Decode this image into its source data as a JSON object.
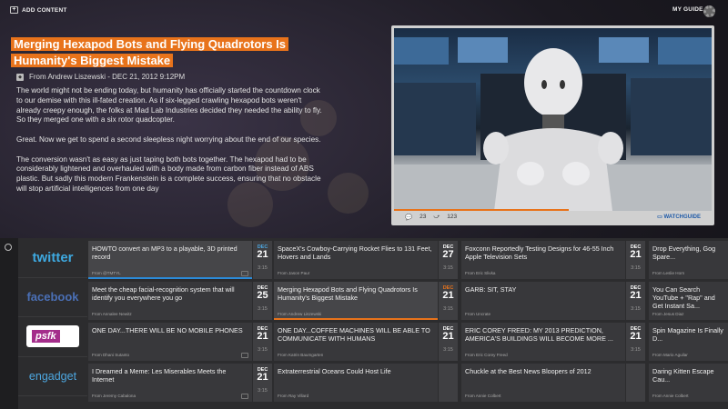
{
  "header": {
    "add_content": "ADD CONTENT",
    "my_guide": "MY GUIDE",
    "add_icon": "plus-square-icon",
    "settings_icon": "gear-icon"
  },
  "article": {
    "title": "Merging Hexapod Bots and Flying Quadrotors Is Humanity's Biggest Mistake",
    "byline": "From Andrew Liszewski - DEC 21, 2012 9:12PM",
    "paragraphs": [
      "The world might not be ending today, but humanity has officially started the countdown clock to our demise with this ill-fated creation. As if six-legged crawling hexapod bots weren't already creepy enough, the folks at Mad Lab Industries decided they needed the ability to fly. So they merged one with a six rotor quadcopter.",
      "Great. Now we get to spend a second sleepless night worrying about the end of our species.",
      "The conversion wasn't as easy as just taping both bots together. The hexapod had to be considerably lightened and overhauled with a body made from carbon fiber instead of ABS plastic. But sadly this modern Frankenstein is a complete success, ensuring that no obstacle will stop artificial intelligences from one day"
    ]
  },
  "video": {
    "comments": "23",
    "shares": "123",
    "watch_guide": "WATCHGUIDE",
    "progress": 0.55
  },
  "sources": [
    "twitter",
    "facebook",
    "psfk",
    "engadget"
  ],
  "rows": [
    [
      {
        "title": "HOWTO convert an MP3 to a playable, 3D printed record",
        "author": "From @TMTYL",
        "month": "DEC",
        "day": "21",
        "time": "3:15",
        "hl": true,
        "accent": "blue"
      },
      {
        "title": "SpaceX's Cowboy-Carrying Rocket Flies to 131 Feet, Hovers and Lands",
        "author": "From Jason Paur",
        "month": "DEC",
        "day": "27",
        "time": "3:15"
      },
      {
        "title": "Foxconn Reportedly Testing Designs for 46-55 Inch Apple Television Sets",
        "author": "From Eric Slivka",
        "month": "DEC",
        "day": "21",
        "time": "3:15"
      },
      {
        "title": "Drop Everything, Gog Spare...",
        "author": "From Leslie Horn",
        "month": "",
        "day": "",
        "time": ""
      }
    ],
    [
      {
        "title": "Meet the cheap facial-recognition system that will identify you everywhere you go",
        "author": "From Annalee Newitz",
        "month": "DEC",
        "day": "25",
        "time": "3:15"
      },
      {
        "title": "Merging Hexapod Bots and Flying Quadrotors Is Humanity's Biggest Mistake",
        "author": "From Andrew Liszewski",
        "month": "DEC",
        "day": "21",
        "time": "3:15",
        "hl": true,
        "accent": "orange"
      },
      {
        "title": "GARB: SIT, STAY",
        "author": "From Uncrate",
        "month": "DEC",
        "day": "21",
        "time": "3:15"
      },
      {
        "title": "You Can Search YouTube + \"Rap\" and Get Instant Sa...",
        "author": "From Jesus Diaz",
        "month": "",
        "day": "",
        "time": ""
      }
    ],
    [
      {
        "title": "ONE DAY...THERE WILL BE NO MOBILE PHONES",
        "author": "From Dhani Sutanto",
        "month": "DEC",
        "day": "21",
        "time": "3:15"
      },
      {
        "title": "ONE DAY...COFFEE MACHINES WILL BE ABLE TO COMMUNICATE WITH HUMANS",
        "author": "From Katrin Baumgarten",
        "month": "DEC",
        "day": "21",
        "time": "3:15"
      },
      {
        "title": "ERIC COREY FREED: MY 2013 PREDICTION, AMERICA'S BUILDINGS WILL BECOME MORE ...",
        "author": "From Eric Corey Freed",
        "month": "DEC",
        "day": "21",
        "time": "3:15"
      },
      {
        "title": "Spin Magazine Is Finally D...",
        "author": "From Mario Aguilar",
        "month": "",
        "day": "",
        "time": ""
      }
    ],
    [
      {
        "title": "I Dreamed a Meme: Les Miserables Meets the Internet",
        "author": "From Jeremy Cabalona",
        "month": "DEC",
        "day": "21",
        "time": "3:15"
      },
      {
        "title": "Extraterrestrial Oceans Could Host Life",
        "author": "From Ray Villard",
        "month": "",
        "day": "",
        "time": ""
      },
      {
        "title": "Chuckle at the Best News Bloopers of 2012",
        "author": "From Annie Colbert",
        "month": "",
        "day": "",
        "time": ""
      },
      {
        "title": "Daring Kitten Escape Cau...",
        "author": "From Annie Colbert",
        "month": "",
        "day": "",
        "time": ""
      }
    ]
  ]
}
